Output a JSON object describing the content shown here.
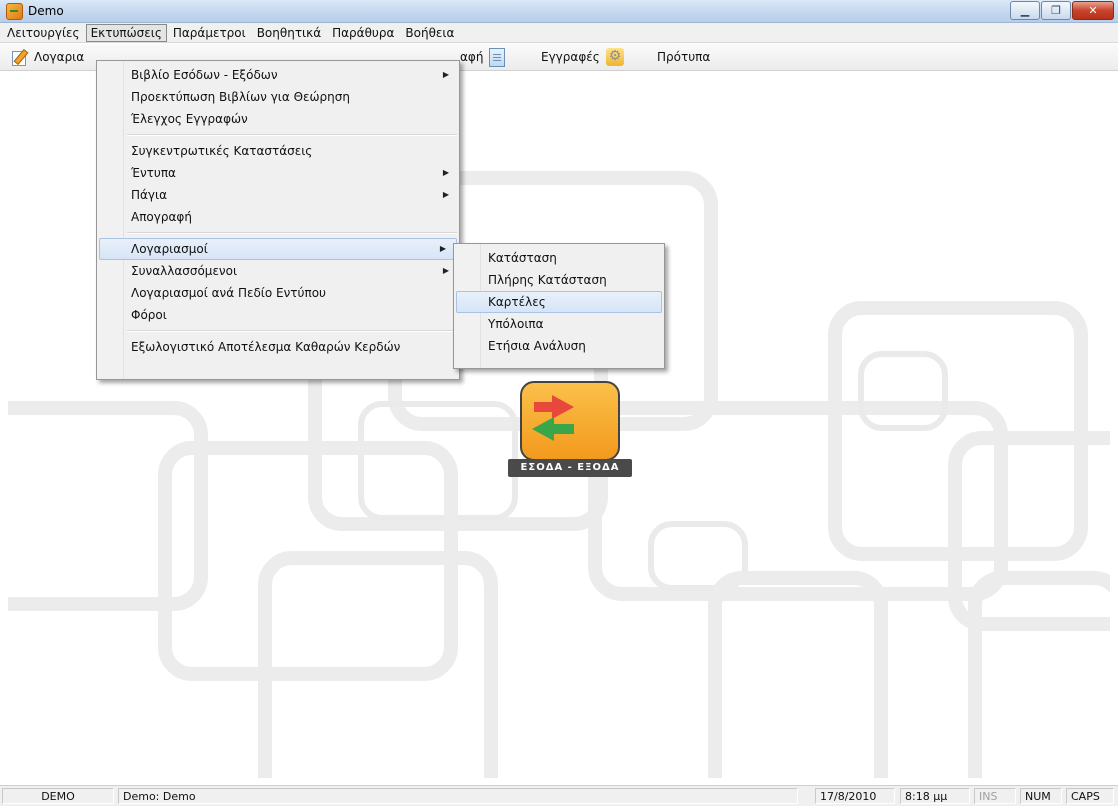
{
  "window": {
    "title": "Demo",
    "icon": "app-icon"
  },
  "menubar": [
    "Λειτουργίες",
    "Εκτυπώσεις",
    "Παράμετροι",
    "Βοηθητικά",
    "Παράθυρα",
    "Βοήθεια"
  ],
  "toolbar": {
    "accounts_label": "Λογαρια",
    "entry_label": "αφή",
    "entries_label": "Εγγραφές",
    "templates_label": "Πρότυπα"
  },
  "prints_menu": {
    "items": [
      "Βιβλίο Εσόδων - Εξόδων",
      "Προεκτύπωση Βιβλίων για Θεώρηση",
      "Έλεγχος Εγγραφών",
      "Συγκεντρωτικές Καταστάσεις",
      "Έντυπα",
      "Πάγια",
      "Απογραφή",
      "Λογαριασμοί",
      "Συναλλασσόμενοι",
      "Λογαριασμοί ανά Πεδίο Εντύπου",
      "Φόροι",
      "Εξωλογιστικό Αποτέλεσμα Καθαρών Κερδών"
    ]
  },
  "accounts_submenu": {
    "items": [
      "Κατάσταση",
      "Πλήρης Κατάσταση",
      "Καρτέλες",
      "Υπόλοιπα",
      "Ετήσια Ανάλυση"
    ]
  },
  "logo": {
    "caption": "ΕΣΟΔΑ - ΕΞΟΔΑ"
  },
  "statusbar": {
    "mode": "DEMO",
    "company": "Demo: Demo",
    "date": "17/8/2010",
    "time": "8:18 μμ",
    "ins": "INS",
    "num": "NUM",
    "caps": "CAPS"
  }
}
